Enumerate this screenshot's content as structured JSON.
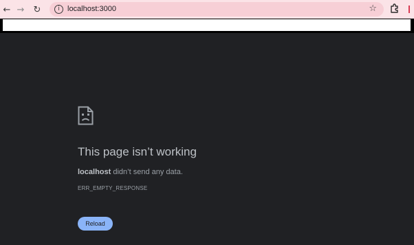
{
  "browser": {
    "url": "localhost:3000",
    "back_icon": "arrow-left-icon",
    "forward_icon": "arrow-right-icon",
    "reload_icon": "refresh-icon",
    "bookmark_icon": "star-icon",
    "extensions_icon": "puzzle-icon"
  },
  "error_page": {
    "icon": "sad-page-icon",
    "title": "This page isn’t working",
    "host": "localhost",
    "message": "didn’t send any data.",
    "error_code": "ERR_EMPTY_RESPONSE",
    "reload_label": "Reload"
  },
  "colors": {
    "page_background": "#202124",
    "toolbar_background": "#fbe3e7",
    "omnibox_background": "#f7cfd6",
    "button_background": "#8ab4f8",
    "heading_text": "#bdc1c6",
    "body_text": "#9aa0a6"
  }
}
